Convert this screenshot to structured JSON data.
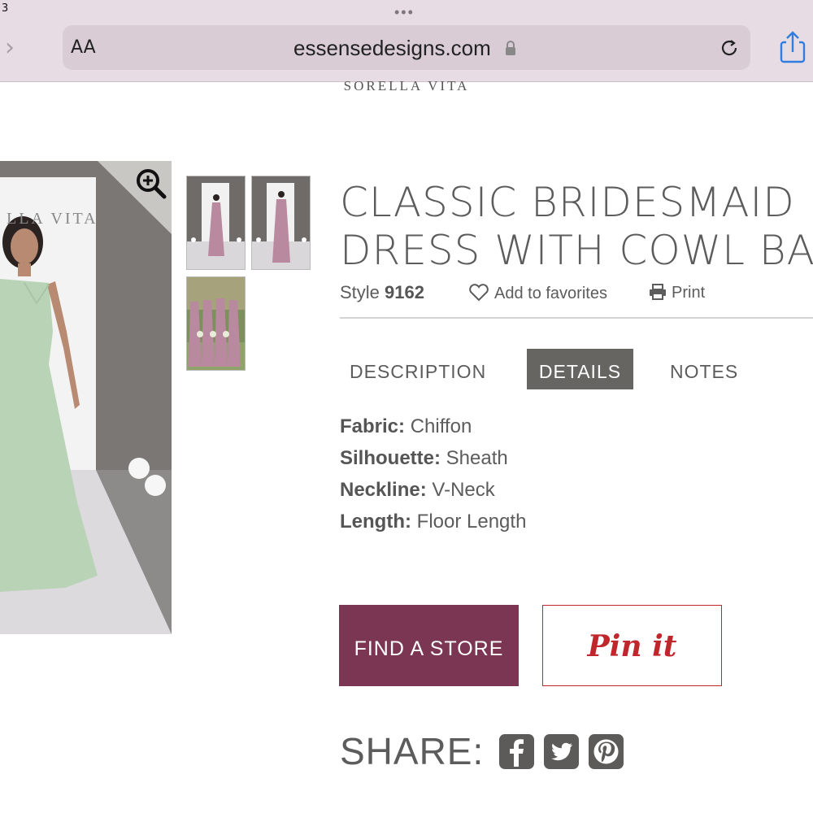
{
  "browser": {
    "status_number": "3",
    "aa_label": "AA",
    "url": "essensedesigns.com"
  },
  "brand": "SORELLA VITA",
  "main_image": {
    "backdrop_text": "LLA  VITA",
    "dress_color": "#b9d3b7"
  },
  "product": {
    "title_line1": "CLASSIC BRIDESMAID",
    "title_line2": "DRESS WITH COWL BAC",
    "style_label": "Style",
    "style_number": "9162",
    "favorites_label": "Add to favorites",
    "print_label": "Print"
  },
  "tabs": [
    {
      "label": "DESCRIPTION",
      "active": false
    },
    {
      "label": "DETAILS",
      "active": true
    },
    {
      "label": "NOTES",
      "active": false
    }
  ],
  "details": [
    {
      "key": "Fabric:",
      "value": "Chiffon"
    },
    {
      "key": "Silhouette:",
      "value": "Sheath"
    },
    {
      "key": "Neckline:",
      "value": "V-Neck"
    },
    {
      "key": "Length:",
      "value": "Floor Length"
    }
  ],
  "buttons": {
    "find_store": "FIND A STORE",
    "pin_it": "Pin it"
  },
  "share": {
    "label": "SHARE:"
  },
  "colors": {
    "accent_button": "#7a3652",
    "pinterest_red": "#c0272d",
    "active_tab": "#676562",
    "dress_mauve": "#b8899f"
  }
}
